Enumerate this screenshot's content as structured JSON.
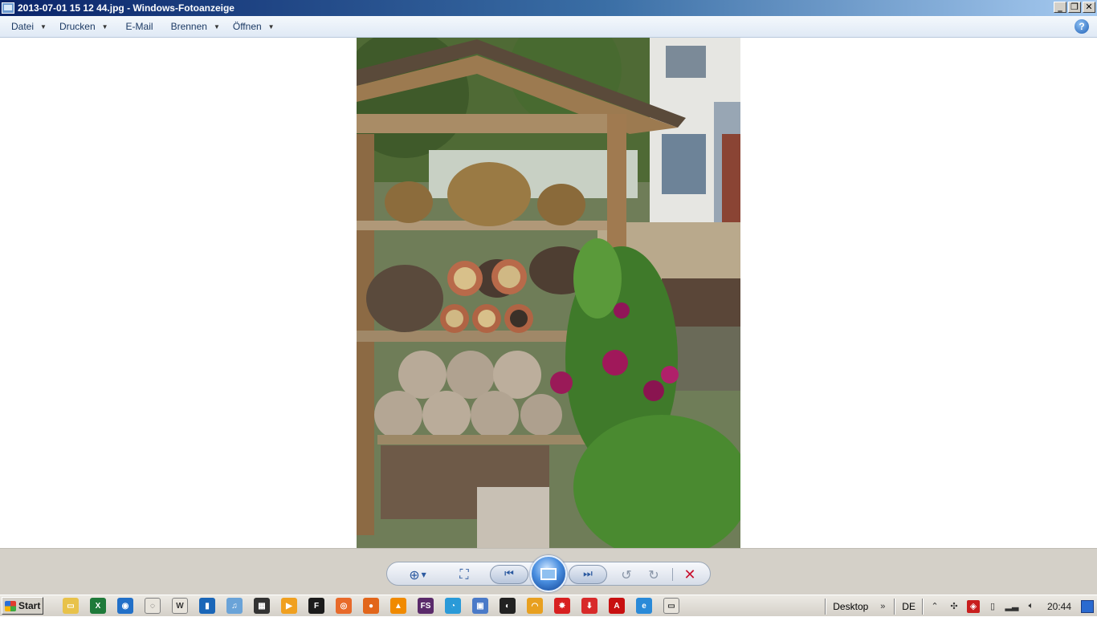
{
  "window": {
    "title": "2013-07-01 15 12 44.jpg - Windows-Fotoanzeige",
    "buttons": {
      "minimize": "_",
      "restore": "❐",
      "close": "✕"
    }
  },
  "menu": {
    "items": [
      {
        "label": "Datei",
        "has_dropdown": true
      },
      {
        "label": "Drucken",
        "has_dropdown": true
      },
      {
        "label": "E-Mail",
        "has_dropdown": false
      },
      {
        "label": "Brennen",
        "has_dropdown": true
      },
      {
        "label": "Öffnen",
        "has_dropdown": true
      }
    ],
    "help_glyph": "?"
  },
  "photo": {
    "subject": "insect hotel with clematis flowers"
  },
  "controls": {
    "zoom_icon": "magnifier-plus-icon",
    "fit_icon": "fit-window-icon",
    "prev_glyph": "⏮",
    "next_glyph": "⏭",
    "rotate_left_glyph": "↺",
    "rotate_right_glyph": "↻",
    "delete_glyph": "✕"
  },
  "taskbar": {
    "start_label": "Start",
    "quick_launch": [
      {
        "name": "explorer",
        "color": "#e8c24a",
        "glyph": "▭"
      },
      {
        "name": "excel",
        "color": "#1f7a3a",
        "glyph": "X"
      },
      {
        "name": "app-blue",
        "color": "#2270c8",
        "glyph": "◉"
      },
      {
        "name": "app-active",
        "color": "#e8e4dc",
        "glyph": "◌",
        "active": true
      },
      {
        "name": "word",
        "color": "#2a5aa8",
        "glyph": "W",
        "active": true
      },
      {
        "name": "app-shield",
        "color": "#1a66b8",
        "glyph": "▮"
      },
      {
        "name": "itunes",
        "color": "#6aa3d8",
        "glyph": "♫"
      },
      {
        "name": "media-player",
        "color": "#333333",
        "glyph": "▦"
      },
      {
        "name": "vlc-like",
        "color": "#f0a020",
        "glyph": "▶"
      },
      {
        "name": "ftp",
        "color": "#1b1b1b",
        "glyph": "F"
      },
      {
        "name": "app-orange",
        "color": "#e86a2a",
        "glyph": "◎"
      },
      {
        "name": "firefox",
        "color": "#e2661b",
        "glyph": "●"
      },
      {
        "name": "vlc",
        "color": "#f08a00",
        "glyph": "▲"
      },
      {
        "name": "fs",
        "color": "#5a2a6a",
        "glyph": "FS"
      },
      {
        "name": "app-cyan",
        "color": "#2a9ad8",
        "glyph": "◔"
      },
      {
        "name": "app-image",
        "color": "#4a7ac8",
        "glyph": "▣"
      },
      {
        "name": "app-black",
        "color": "#222222",
        "glyph": "◐"
      },
      {
        "name": "headphones",
        "color": "#e8a020",
        "glyph": "◠"
      },
      {
        "name": "app-star",
        "color": "#d82020",
        "glyph": "✸"
      },
      {
        "name": "app-download",
        "color": "#d82a2a",
        "glyph": "⬇"
      },
      {
        "name": "acrobat",
        "color": "#c81010",
        "glyph": "A"
      },
      {
        "name": "ie",
        "color": "#2a8ad8",
        "glyph": "e"
      },
      {
        "name": "photo-viewer",
        "color": "#e8e4dc",
        "glyph": "▭",
        "active": true
      }
    ],
    "tray": {
      "desktop_label": "Desktop",
      "language": "DE",
      "clock": "20:44"
    }
  }
}
